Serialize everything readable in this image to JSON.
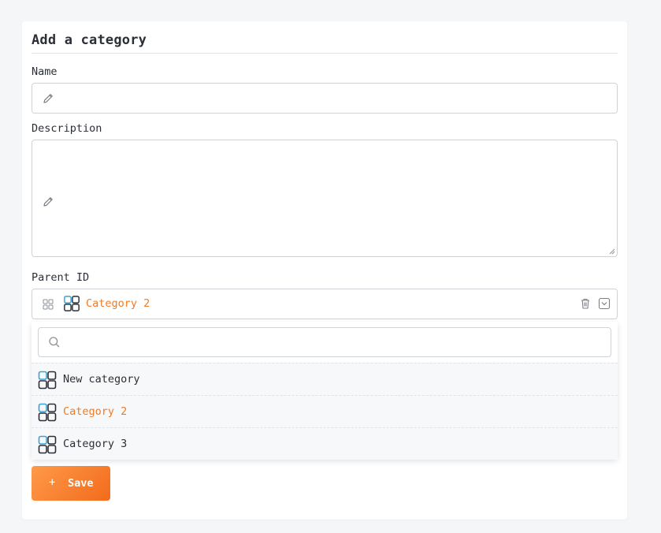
{
  "form": {
    "title": "Add a category",
    "name_label": "Name",
    "name_value": "",
    "description_label": "Description",
    "description_value": "",
    "parent_label": "Parent ID",
    "parent_selected": "Category 2",
    "save_label": "Save",
    "save_icon": "+"
  },
  "dropdown": {
    "search_value": "",
    "options": [
      {
        "label": "New category",
        "selected": false
      },
      {
        "label": "Category 2",
        "selected": true
      },
      {
        "label": "Category 3",
        "selected": false
      }
    ]
  },
  "colors": {
    "accent": "#f07b22",
    "category_icon_light": "#3aa3d8",
    "category_icon_dark": "#2b2f36"
  }
}
